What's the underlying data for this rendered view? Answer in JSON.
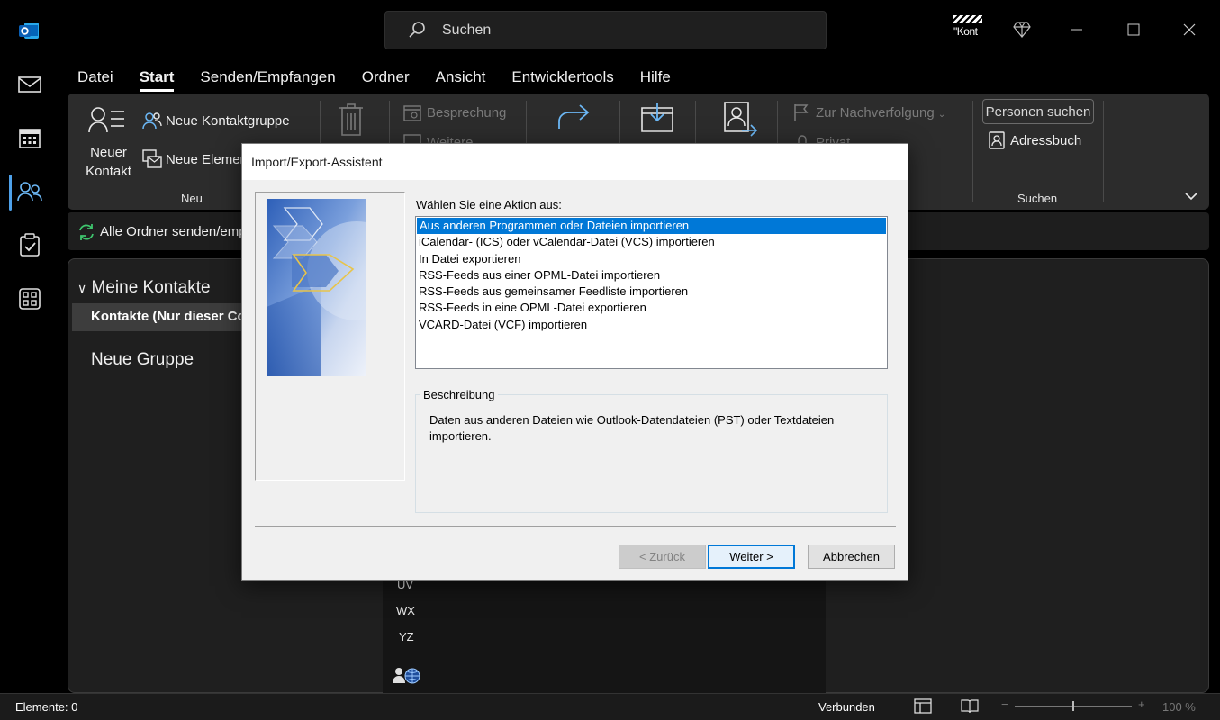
{
  "titlebar": {
    "search_placeholder": "Suchen",
    "profile_label": "\"Kont"
  },
  "menu": {
    "tabs": [
      "Datei",
      "Start",
      "Senden/Empfangen",
      "Ordner",
      "Ansicht",
      "Entwicklertools",
      "Hilfe"
    ],
    "active": "Start"
  },
  "ribbon": {
    "new_contact": [
      "Neuer",
      "Kontakt"
    ],
    "new_contact_group": "Neue Kontaktgruppe",
    "new_items": "Neue Elemente",
    "group_new": "Neu",
    "meeting": "Besprechung",
    "more": "Weitere",
    "follow_up": "Zur Nachverfolgung",
    "private": "Privat",
    "find_people": "Personen suchen",
    "address_book": "Adressbuch",
    "group_find": "Suchen"
  },
  "subbar": {
    "send_all": "Alle Ordner senden/empfangen"
  },
  "folders": {
    "header": "Meine Kontakte",
    "selected": "Kontakte (Nur dieser Computer)",
    "new_group": "Neue Gruppe"
  },
  "alpha_index": [
    "UV",
    "WX",
    "YZ"
  ],
  "statusbar": {
    "items": "Elemente: 0",
    "connection": "Verbunden",
    "zoom": "100 %"
  },
  "dialog": {
    "title": "Import/Export-Assistent",
    "prompt": "Wählen Sie eine Aktion aus:",
    "actions": [
      "Aus anderen Programmen oder Dateien importieren",
      "iCalendar- (ICS) oder vCalendar-Datei (VCS) importieren",
      "In Datei exportieren",
      "RSS-Feeds aus einer OPML-Datei importieren",
      "RSS-Feeds aus gemeinsamer Feedliste importieren",
      "RSS-Feeds in eine OPML-Datei exportieren",
      "VCARD-Datei (VCF) importieren"
    ],
    "selected_index": 0,
    "description_label": "Beschreibung",
    "description": "Daten aus anderen Dateien wie Outlook-Datendateien (PST) oder Textdateien importieren.",
    "back_button": "< Zurück",
    "next_button": "Weiter >",
    "cancel_button": "Abbrechen"
  },
  "colors": {
    "accent": "#0078d7",
    "rail_active": "#4ea1ea",
    "background": "#000000",
    "ribbon": "#2c2c2c"
  }
}
